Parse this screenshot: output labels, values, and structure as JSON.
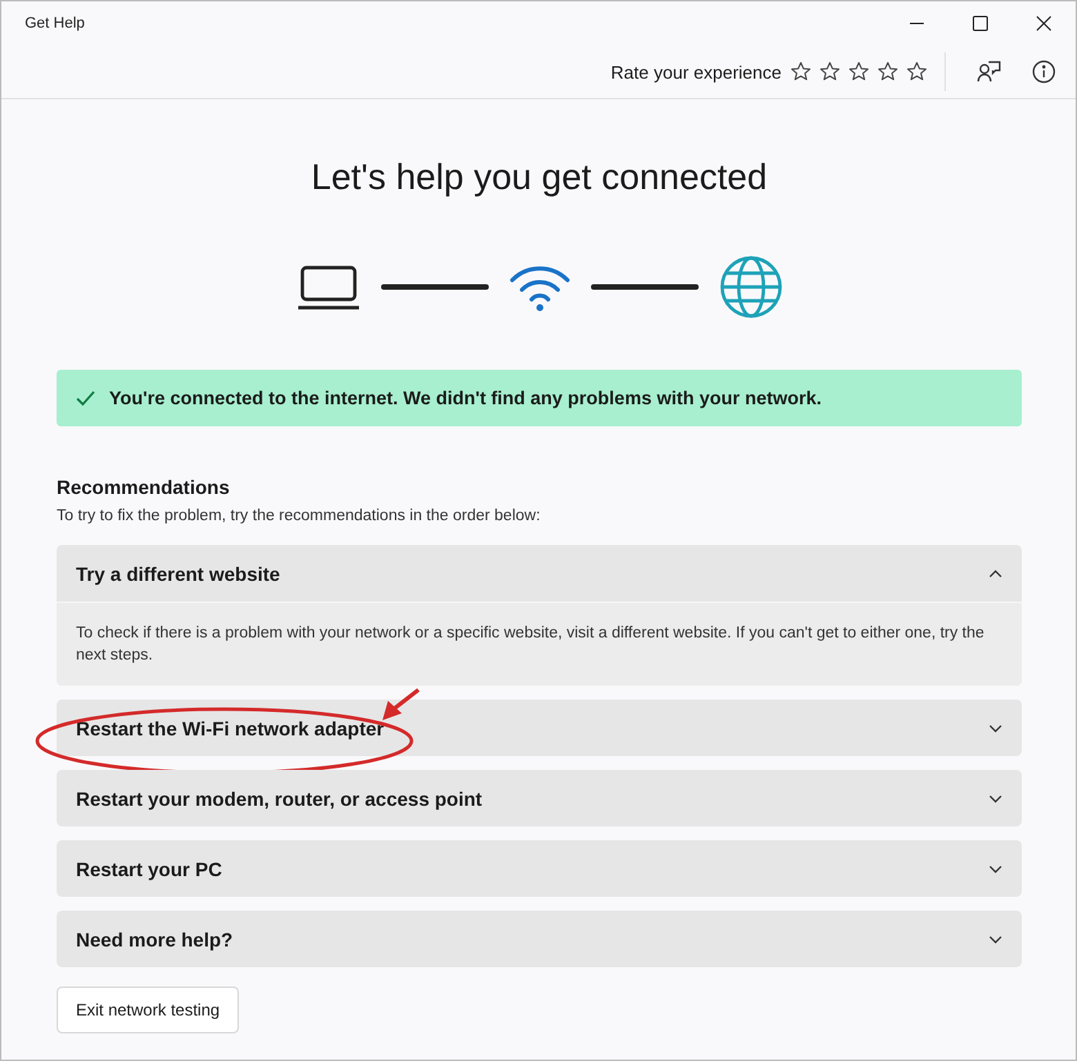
{
  "window": {
    "title": "Get Help"
  },
  "rating": {
    "label": "Rate your experience",
    "stars": 0
  },
  "heading": "Let's help you get connected",
  "status": {
    "message": "You're connected to the internet. We didn't find any problems with your network."
  },
  "recommendations": {
    "title": "Recommendations",
    "subtitle": "To try to fix the problem, try the recommendations in the order below:",
    "items": [
      {
        "title": "Try a different website",
        "expanded": true,
        "highlighted": false,
        "body": "To check if there is a problem with your network or a specific website, visit a different website. If you can't get to either one, try the next steps."
      },
      {
        "title": "Restart the Wi-Fi network adapter",
        "expanded": false,
        "highlighted": true
      },
      {
        "title": "Restart your modem, router, or access point",
        "expanded": false,
        "highlighted": false
      },
      {
        "title": "Restart your PC",
        "expanded": false,
        "highlighted": false
      },
      {
        "title": "Need more help?",
        "expanded": false,
        "highlighted": false
      }
    ]
  },
  "exit_button": "Exit network testing"
}
